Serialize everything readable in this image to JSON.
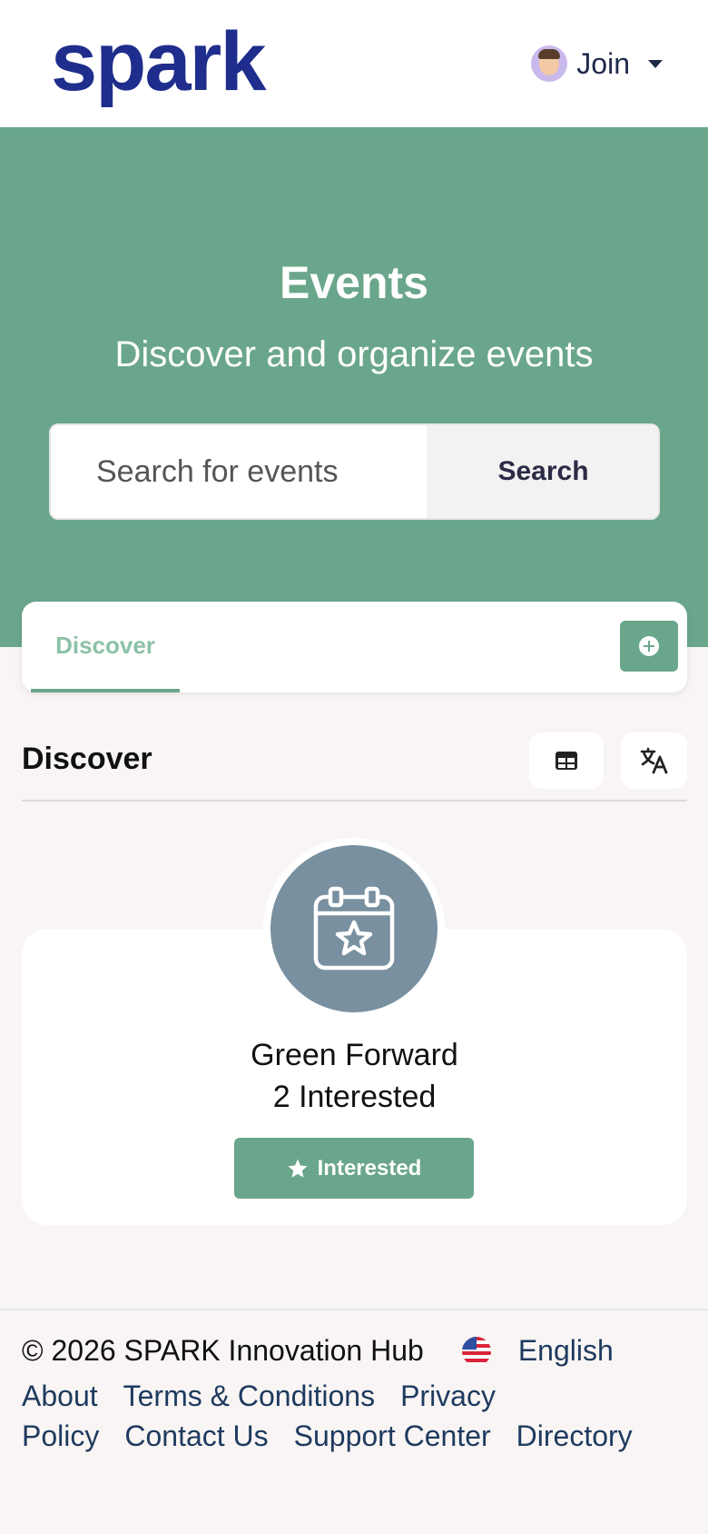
{
  "header": {
    "logo": "spark",
    "join_label": "Join"
  },
  "hero": {
    "title": "Events",
    "subtitle": "Discover and organize events",
    "search_placeholder": "Search for events",
    "search_button": "Search",
    "accent_color": "#6aa68b"
  },
  "tabs": {
    "discover": "Discover"
  },
  "section": {
    "title": "Discover"
  },
  "event": {
    "name": "Green Forward",
    "count": "2 Interested",
    "button": "Interested"
  },
  "footer": {
    "copyright": "© 2026 SPARK Innovation Hub",
    "language": "English",
    "links": [
      "About",
      "Terms & Conditions",
      "Privacy Policy",
      "Contact Us",
      "Support Center",
      "Directory"
    ]
  },
  "icons": {
    "avatar": "user-avatar-icon",
    "caret": "chevron-down-icon",
    "add": "plus-circle-icon",
    "grid": "table-grid-icon",
    "translate": "translate-icon",
    "event": "calendar-star-icon",
    "interested": "star-icon",
    "flag": "us-flag-icon"
  }
}
